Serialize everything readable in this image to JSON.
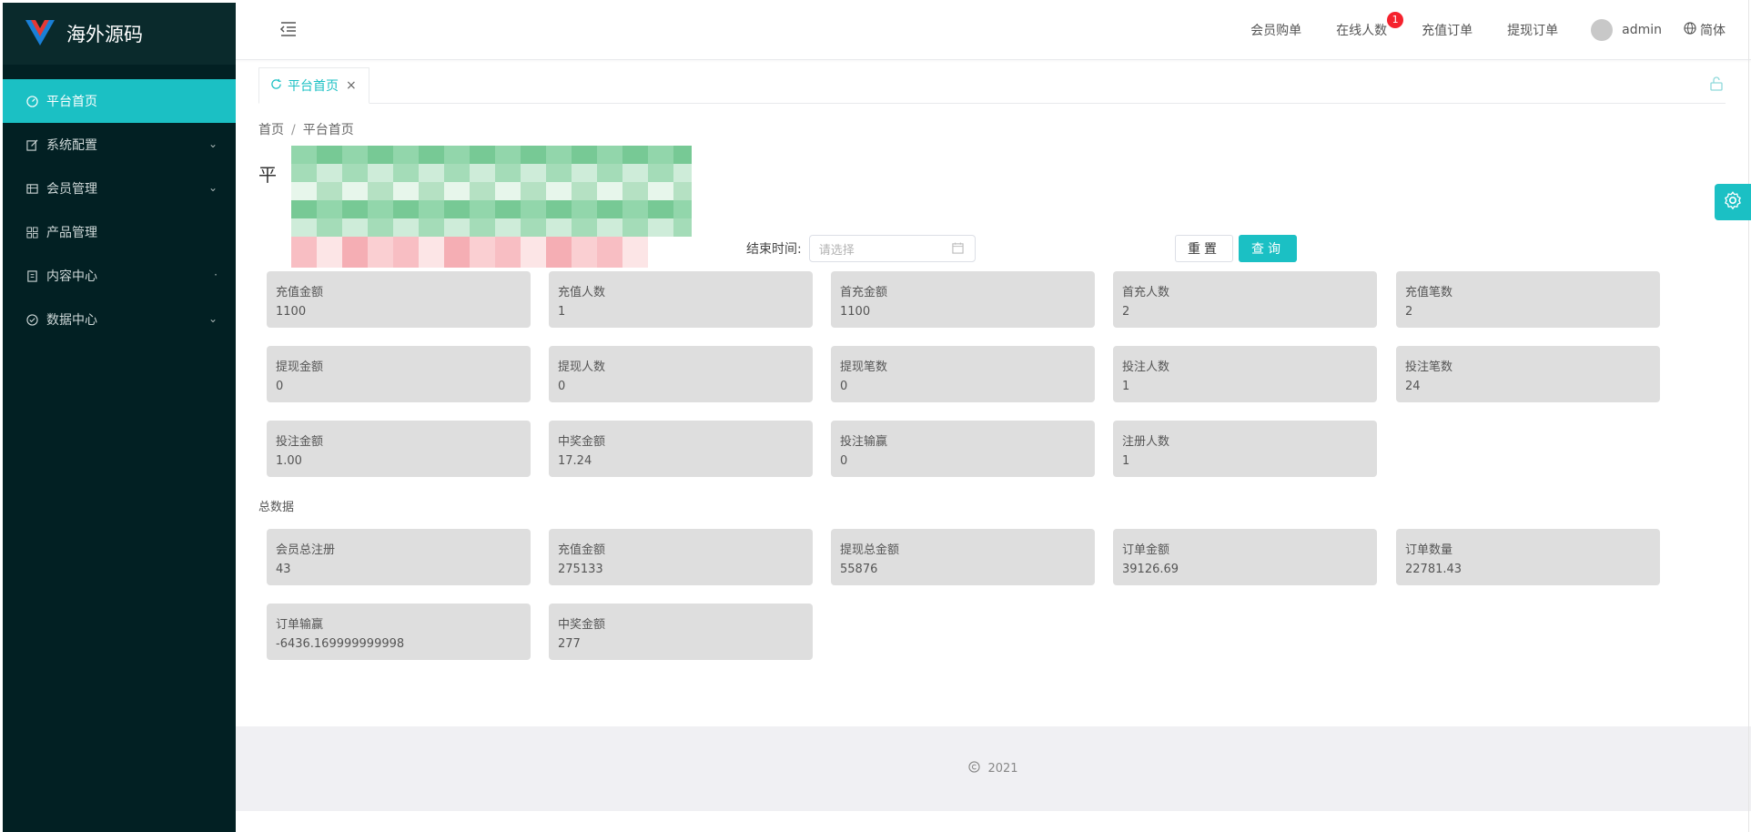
{
  "app": {
    "name": "海外源码"
  },
  "sidebar": {
    "items": [
      {
        "label": "平台首页",
        "icon": "dashboard-icon",
        "active": true
      },
      {
        "label": "系统配置",
        "icon": "edit-icon",
        "has_children": true
      },
      {
        "label": "会员管理",
        "icon": "table-icon",
        "has_children": true
      },
      {
        "label": "产品管理",
        "icon": "grid-icon",
        "has_children": false
      },
      {
        "label": "内容中心",
        "icon": "document-icon",
        "has_children": true
      },
      {
        "label": "数据中心",
        "icon": "check-circle-icon",
        "has_children": true
      }
    ]
  },
  "header": {
    "links": [
      "会员购单",
      "在线人数",
      "充值订单",
      "提现订单"
    ],
    "online_badge": "1",
    "user": "admin",
    "language": "简体"
  },
  "tabs": [
    {
      "label": "平台首页"
    }
  ],
  "breadcrumb": {
    "home": "首页",
    "current": "平台首页"
  },
  "page_title": "平",
  "filter": {
    "end_label": "结束时间:",
    "end_placeholder": "请选择",
    "reset_label": "重置",
    "query_label": "查询"
  },
  "today_stats": [
    {
      "label": "充值金额",
      "value": "1100"
    },
    {
      "label": "充值人数",
      "value": "1"
    },
    {
      "label": "首充金额",
      "value": "1100"
    },
    {
      "label": "首充人数",
      "value": "2"
    },
    {
      "label": "充值笔数",
      "value": "2"
    },
    {
      "label": "提现金额",
      "value": "0"
    },
    {
      "label": "提现人数",
      "value": "0"
    },
    {
      "label": "提现笔数",
      "value": "0"
    },
    {
      "label": "投注人数",
      "value": "1"
    },
    {
      "label": "投注笔数",
      "value": "24"
    },
    {
      "label": "投注金额",
      "value": "1.00"
    },
    {
      "label": "中奖金额",
      "value": "17.24"
    },
    {
      "label": "投注输赢",
      "value": "0"
    },
    {
      "label": "注册人数",
      "value": "1"
    }
  ],
  "total_section_label": "总数据",
  "total_stats": [
    {
      "label": "会员总注册",
      "value": "43"
    },
    {
      "label": "充值金额",
      "value": "275133"
    },
    {
      "label": "提现总金额",
      "value": "55876"
    },
    {
      "label": "订单金额",
      "value": "39126.69"
    },
    {
      "label": "订单数量",
      "value": "22781.43"
    },
    {
      "label": "订单输赢",
      "value": "-6436.169999999998"
    },
    {
      "label": "中奖金额",
      "value": "277"
    }
  ],
  "footer": {
    "year": "2021"
  },
  "colors": {
    "accent": "#1bc0c4",
    "sidebar_bg": "#022023",
    "badge": "#f5222d",
    "card_bg": "#dedede"
  }
}
